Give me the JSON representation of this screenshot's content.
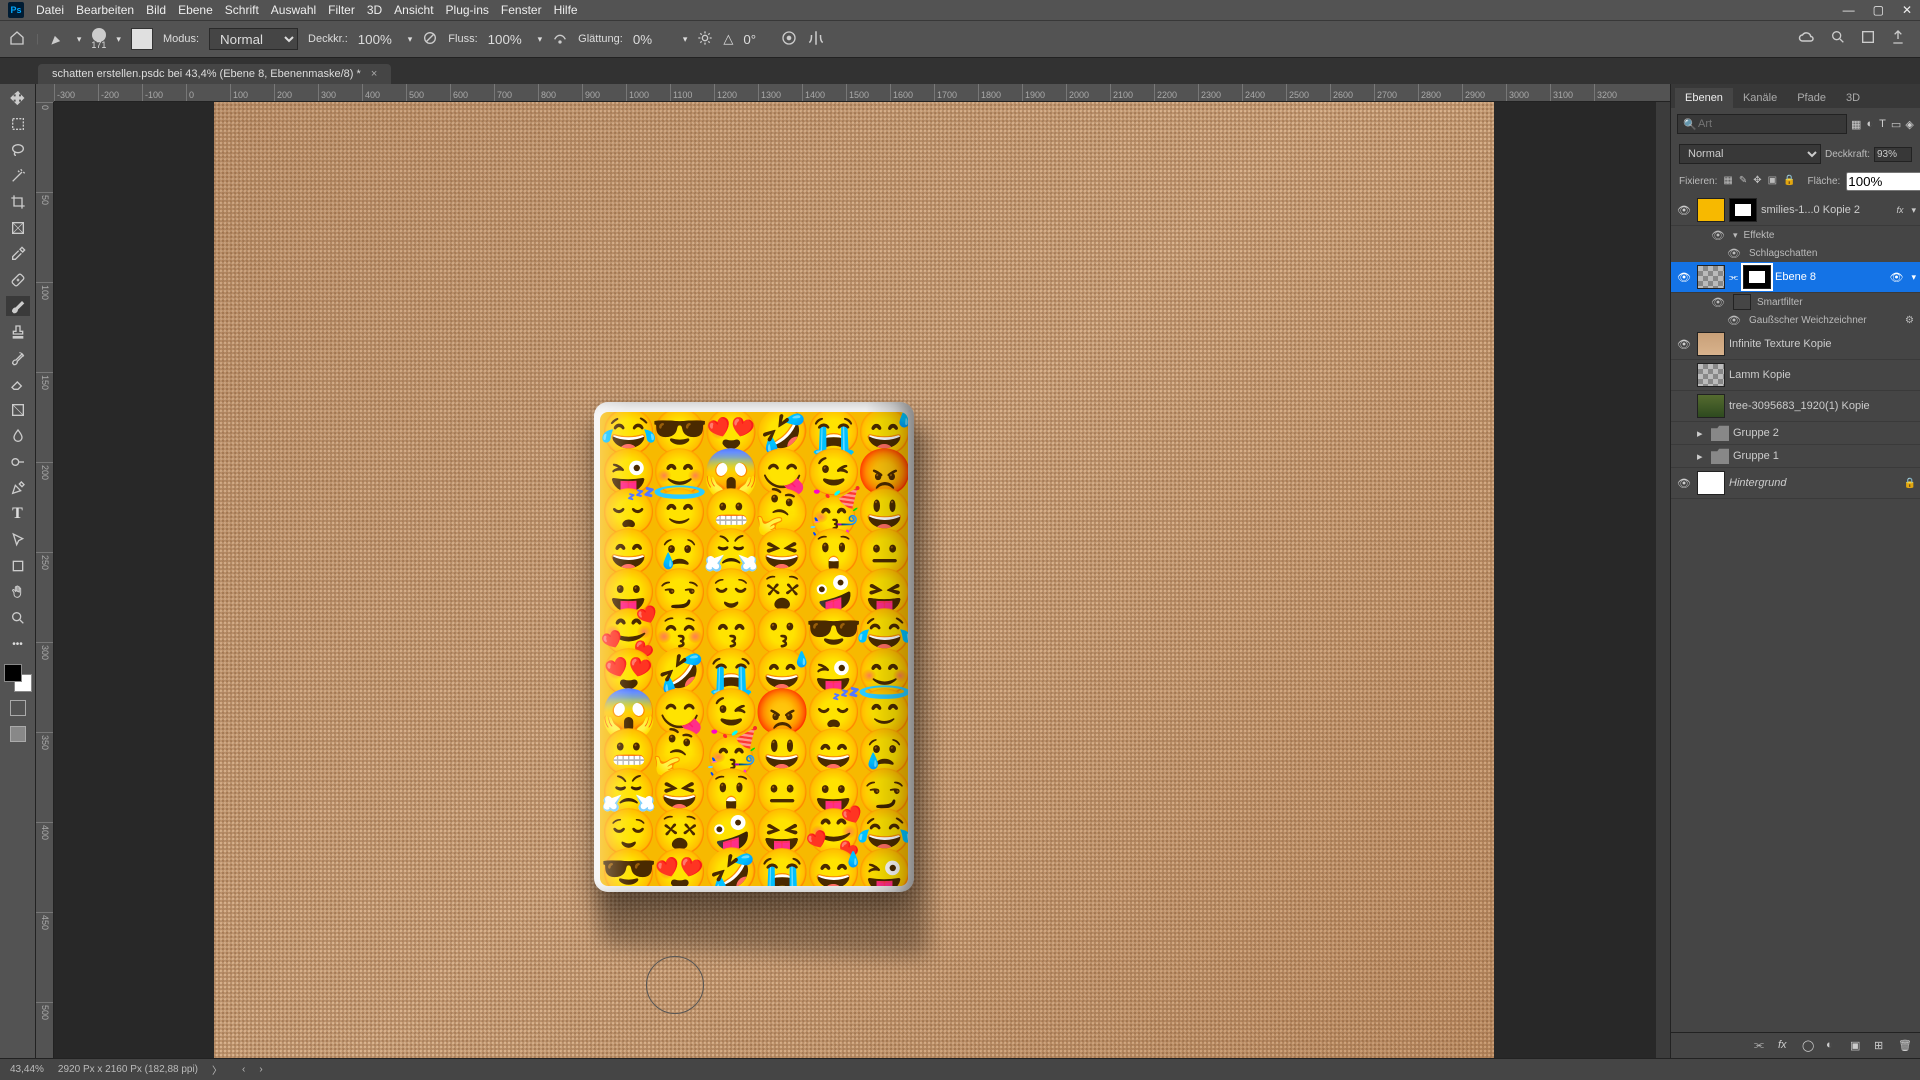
{
  "menu": {
    "items": [
      "Datei",
      "Bearbeiten",
      "Bild",
      "Ebene",
      "Schrift",
      "Auswahl",
      "Filter",
      "3D",
      "Ansicht",
      "Plug-ins",
      "Fenster",
      "Hilfe"
    ]
  },
  "options_bar": {
    "brush_size": "171",
    "mode_label": "Modus:",
    "mode_value": "Normal",
    "opacity_label": "Deckkr.:",
    "opacity_value": "100%",
    "flow_label": "Fluss:",
    "flow_value": "100%",
    "smoothing_label": "Glättung:",
    "smoothing_value": "0%",
    "angle_value": "0°"
  },
  "document": {
    "tab_title": "schatten erstellen.psdc bei 43,4% (Ebene 8, Ebenenmaske/8) *"
  },
  "ruler_h": [
    "-300",
    "-200",
    "-100",
    "0",
    "100",
    "200",
    "300",
    "400",
    "500",
    "600",
    "700",
    "800",
    "900",
    "1000",
    "1100",
    "1200",
    "1300",
    "1400",
    "1500",
    "1600",
    "1700",
    "1800",
    "1900",
    "2000",
    "2100",
    "2200",
    "2300",
    "2400",
    "2500",
    "2600",
    "2700",
    "2800",
    "2900",
    "3000",
    "3100",
    "3200"
  ],
  "ruler_v": [
    "0",
    "50",
    "100",
    "150",
    "200",
    "250",
    "300",
    "350",
    "400",
    "450",
    "500"
  ],
  "panels": {
    "tabs": [
      "Ebenen",
      "Kanäle",
      "Pfade",
      "3D"
    ],
    "search_placeholder": "Art",
    "blend_mode": "Normal",
    "opacity_label": "Deckkraft:",
    "opacity_value": "93%",
    "lock_label": "Fixieren:",
    "fill_label": "Fläche:",
    "fill_value": "100%"
  },
  "layers": [
    {
      "visible": true,
      "thumb": "smilies",
      "mask": true,
      "name": "smilies-1...0 Kopie 2",
      "fx": "fx",
      "expanded": true
    },
    {
      "sub": true,
      "visible": true,
      "name": "Effekte"
    },
    {
      "sub": true,
      "visible": true,
      "name": "Schlagschatten",
      "indent": true
    },
    {
      "visible": true,
      "thumb": "checker",
      "mask": true,
      "name": "Ebene 8",
      "selected": true,
      "linked": true,
      "expanded": true
    },
    {
      "sub": true,
      "visible": true,
      "name": "Smartfilter",
      "smartthumb": true
    },
    {
      "sub": true,
      "visible": true,
      "name": "Gaußscher Weichzeichner",
      "indent": true,
      "gear": true
    },
    {
      "visible": true,
      "thumb": "texture",
      "name": "Infinite Texture Kopie"
    },
    {
      "visible": false,
      "thumb": "checker",
      "name": "Lamm Kopie"
    },
    {
      "visible": false,
      "thumb": "tree",
      "name": "tree-3095683_1920(1) Kopie"
    },
    {
      "visible": false,
      "folder": true,
      "name": "Gruppe 2",
      "chev": true
    },
    {
      "visible": false,
      "folder": true,
      "name": "Gruppe 1",
      "chev": true
    },
    {
      "visible": true,
      "thumb": "white",
      "name": "Hintergrund",
      "italic": true,
      "locked": true
    }
  ],
  "status": {
    "zoom": "43,44%",
    "doc_size": "2920 Px x 2160 Px (182,88 ppi)"
  },
  "emoji_chars": "😂😎😍🤣😭😅😜😊😱😋😉😡😴😇😬🤔🥳😃😄😢😤😆😲😐😛😏😌😵🤪😝🥰😚😙😗😎😂😍🤣😭😅😜😊😱😋😉😡😴😇😬🤔🥳😃😄😢😤😆😲😐😛😏😌😵🤪😝🥰😂😎😍🤣😭😅😜😊😱"
}
